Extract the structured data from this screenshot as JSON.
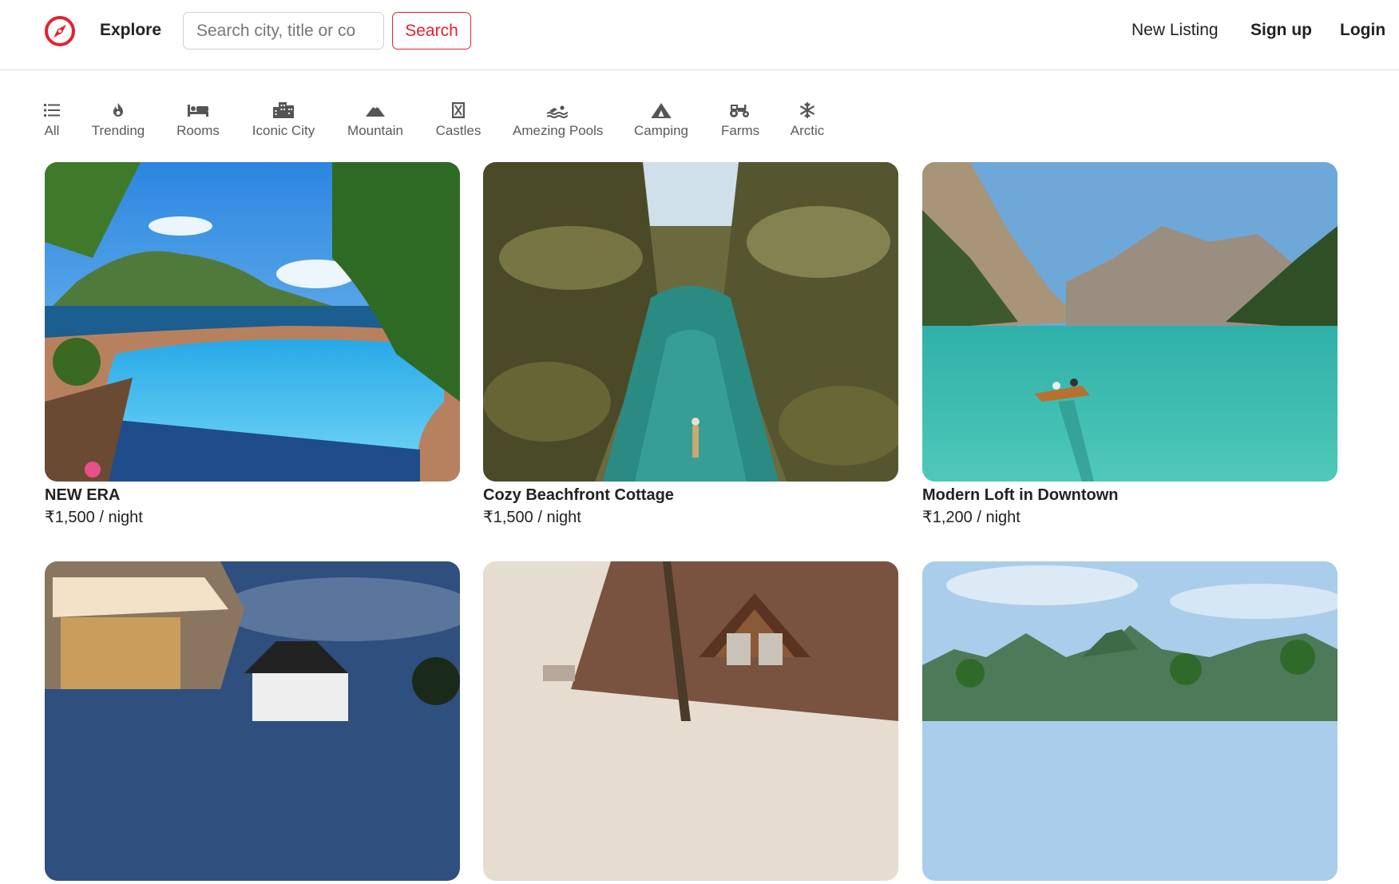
{
  "nav": {
    "brand_label": "Explore",
    "search_placeholder": "Search city, title or co",
    "search_button": "Search",
    "new_listing": "New Listing",
    "signup": "Sign up",
    "login": "Login",
    "accent_color": "#e4212f"
  },
  "filters": [
    {
      "label": "All",
      "icon": "list-icon"
    },
    {
      "label": "Trending",
      "icon": "fire-icon"
    },
    {
      "label": "Rooms",
      "icon": "bed-icon"
    },
    {
      "label": "Iconic City",
      "icon": "city-icon"
    },
    {
      "label": "Mountain",
      "icon": "mountain-icon"
    },
    {
      "label": "Castles",
      "icon": "castle-icon"
    },
    {
      "label": "Amezing Pools",
      "icon": "swimmer-icon"
    },
    {
      "label": "Camping",
      "icon": "tent-icon"
    },
    {
      "label": "Farms",
      "icon": "tractor-icon"
    },
    {
      "label": "Arctic",
      "icon": "snowflake-icon"
    }
  ],
  "listings": [
    {
      "title": "NEW ERA",
      "price": "₹1,500 / night"
    },
    {
      "title": "Cozy Beachfront Cottage",
      "price": "₹1,500 / night"
    },
    {
      "title": "Modern Loft in Downtown",
      "price": "₹1,200 / night"
    },
    {
      "title": "",
      "price": ""
    },
    {
      "title": "",
      "price": ""
    },
    {
      "title": "",
      "price": ""
    }
  ]
}
